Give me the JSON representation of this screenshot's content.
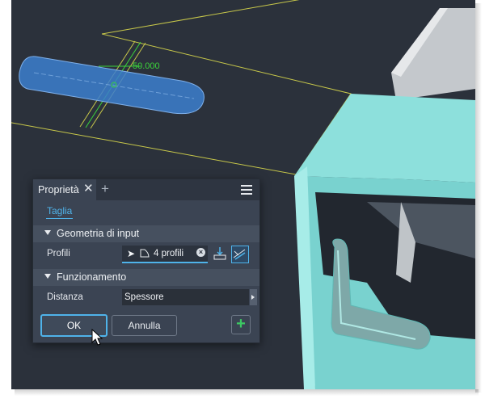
{
  "dimension_label": "50.000",
  "panel": {
    "tab_title": "Proprietà",
    "close_glyph": "✕",
    "add_glyph": "+",
    "menu_icon": "hamburger-menu-icon",
    "subtab": "Taglia",
    "section_input": "Geometria di input",
    "profiles_label": "Profili",
    "profiles_value": "4 profili",
    "section_behavior": "Funzionamento",
    "distance_label": "Distanza",
    "distance_value": "Spessore",
    "ok_label": "OK",
    "cancel_label": "Annulla",
    "plus_label": "+"
  },
  "colors": {
    "accent": "#4fb3ea",
    "viewport_bg": "#2b313b",
    "panel_bg": "#3b4453",
    "sketch_line": "#c8c84a",
    "profile_fill": "#3c7fcf",
    "part_teal": "#8de0dc",
    "dimension_green": "#3bd43b",
    "plus_green": "#3cc863"
  }
}
